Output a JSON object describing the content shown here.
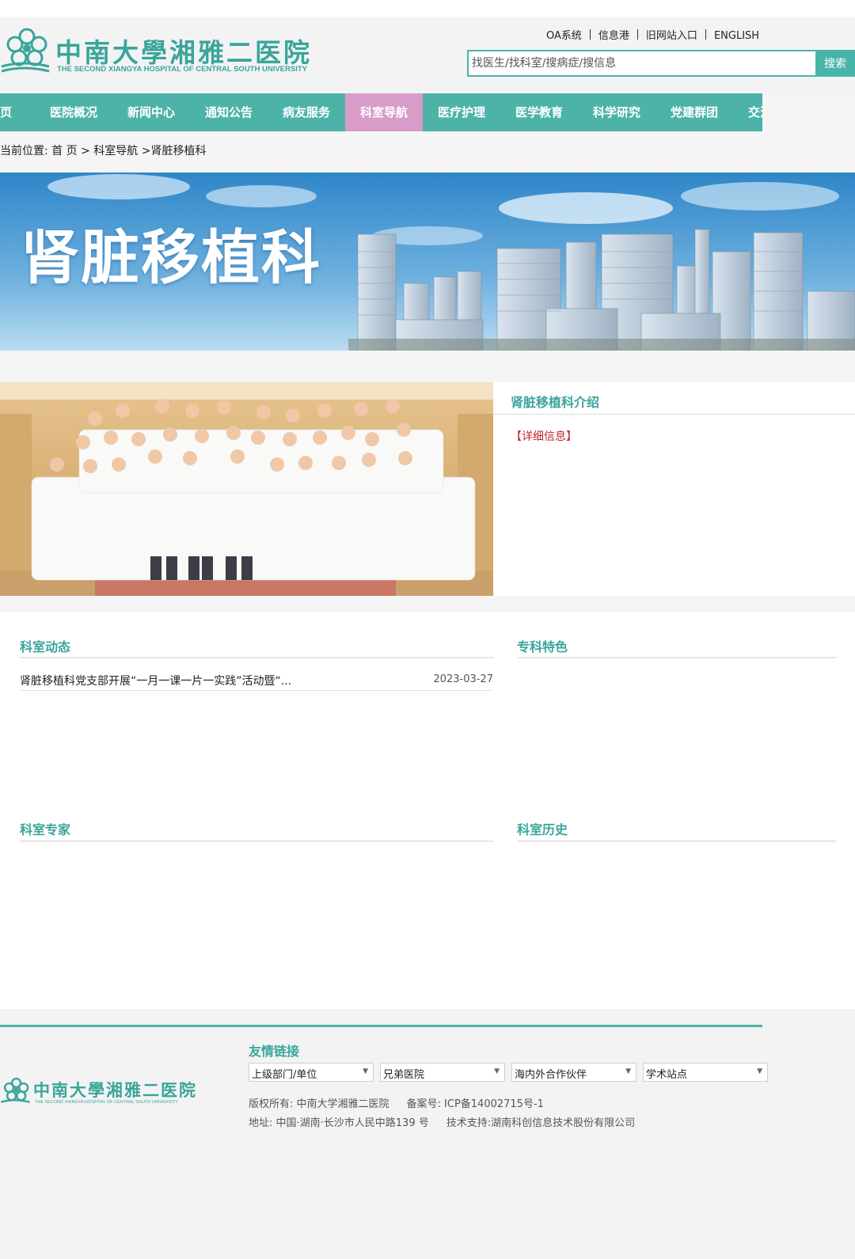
{
  "header": {
    "logo_cn": "中南大學湘雅二医院",
    "logo_en": "THE SECOND XIANGYA HOSPITAL OF CENTRAL SOUTH UNIVERSITY",
    "top_links": [
      "OA系统",
      "信息港",
      "旧网站入口",
      "ENGLISH"
    ],
    "search_placeholder": "找医生/找科室/搜病症/搜信息",
    "search_button": "搜索"
  },
  "nav": {
    "items": [
      "页",
      "医院概况",
      "新闻中心",
      "通知公告",
      "病友服务",
      "科室导航",
      "医疗护理",
      "医学教育",
      "科学研究",
      "党建群团",
      "交流合作"
    ],
    "active_index": 5
  },
  "breadcrumb": {
    "label": "当前位置:",
    "home": "首 页",
    "sep1": ">",
    "section": "科室导航",
    "sep2": ">",
    "current": "肾脏移植科"
  },
  "banner": {
    "title": "肾脏移植科"
  },
  "intro": {
    "title": "肾脏移植科介绍",
    "detail_link": "【详细信息】"
  },
  "sections": {
    "news": {
      "title": "科室动态",
      "items": [
        {
          "title": "肾脏移植科党支部开展“一月一课一片一实践”活动暨“...",
          "date": "2023-03-27"
        }
      ]
    },
    "features": {
      "title": "专科特色"
    },
    "experts": {
      "title": "科室专家"
    },
    "history": {
      "title": "科室历史"
    }
  },
  "footer": {
    "logo_cn": "中南大學湘雅二医院",
    "logo_en": "THE SECOND XIANGYA HOSPITAL OF CENTRAL SOUTH UNIVERSITY",
    "friend_links_title": "友情链接",
    "selects": [
      "上级部门/单位",
      "兄弟医院",
      "海内外合作伙伴",
      "学术站点"
    ],
    "copyright": "版权所有: 中南大学湘雅二医院",
    "icp": "备案号: ICP备14002715号-1",
    "address": "地址: 中国·湖南·长沙市人民中路139 号",
    "tech_support": "技术支持:湖南科创信息技术股份有限公司"
  },
  "colors": {
    "brand_teal": "#4db3a8",
    "nav_active_pink": "#d99bc7",
    "link_red": "#c0282d"
  }
}
